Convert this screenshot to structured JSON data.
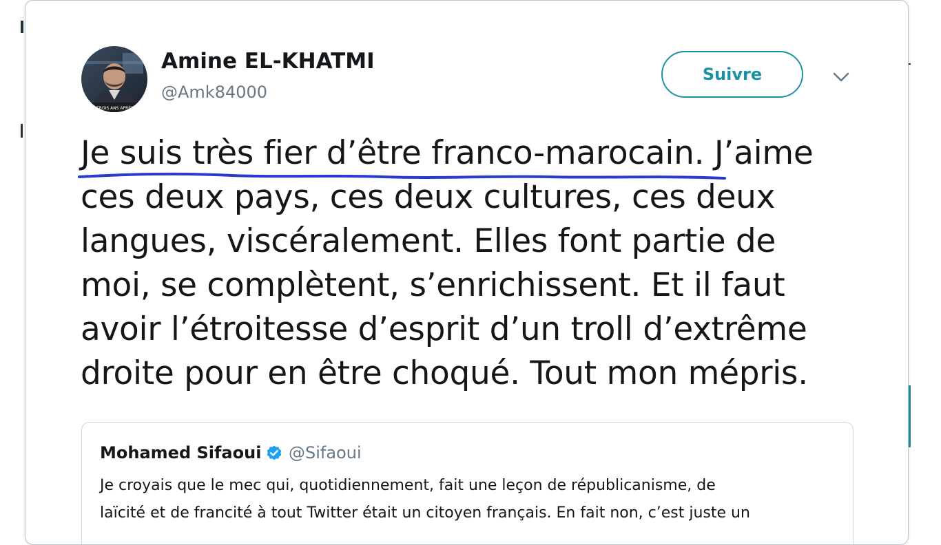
{
  "tweet": {
    "author": {
      "name": "Amine EL-KHATMI",
      "handle": "@Amk84000",
      "avatar_caption": "TROIS ANS APRÈS"
    },
    "follow_label": "Suivre",
    "text_lines": [
      "Je suis très fier d’être franco-marocain. J’aime",
      "ces deux pays, ces deux cultures, ces deux",
      "langues, viscéralement. Elles font partie de",
      "moi, se complètent, s’enrichissent. Et il faut",
      "avoir l’étroitesse d’esprit d’un troll d’extrême",
      "droite pour en être choqué. Tout mon mépris."
    ],
    "underline_color": "#2a3bd1"
  },
  "quoted_tweet": {
    "author": {
      "name": "Mohamed Sifaoui",
      "handle": "@Sifaoui",
      "verified": true
    },
    "text_lines": [
      "Je croyais que le mec qui, quotidiennement, fait une leçon de républicanisme, de",
      "laïcité et de francité à tout Twitter était un citoyen français. En fait non, c’est juste un"
    ]
  },
  "colors": {
    "accent": "#1a91a2",
    "verified": "#1da1f2",
    "text": "#14171a",
    "secondary_text": "#657786"
  }
}
